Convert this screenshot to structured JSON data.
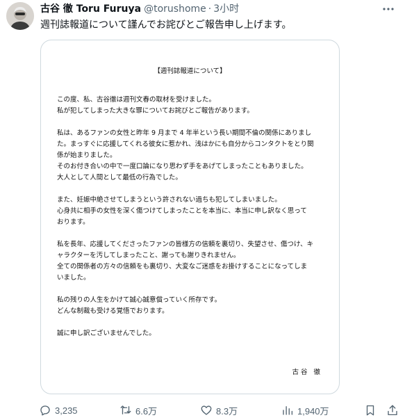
{
  "author": {
    "display_name": "古谷 徹 Toru Furuya",
    "handle": "@torushome",
    "separator": "·",
    "time": "3小时"
  },
  "tweet": {
    "text": "週刊誌報道について謹んでお詫びとご報告申し上げます。"
  },
  "document": {
    "title": "【週刊誌報道について】",
    "paragraphs": [
      [
        "この度、私、古谷徹は週刊文春の取材を受けました。",
        "私が犯してしまった大きな罪についてお詫びとご報告があります。"
      ],
      [
        "私は、あるファンの女性と昨年 9 月まで 4 年半という長い期間不倫の関係にありまし",
        "た。まっすぐに応援してくれる彼女に惹かれ、浅はかにも自分からコンタクトをとり関",
        "係が始まりました。",
        "そのお付き合いの中で一度口論になり思わず手をあげてしまったこともありました。",
        "大人として人間として最低の行為でした。"
      ],
      [
        "また、妊娠中絶させてしまうという許されない過ちも犯してしまいました。",
        "心身共に相手の女性を深く傷つけてしまったことを本当に、本当に申し訳なく思って",
        "おります。"
      ],
      [
        "私を長年、応援してくださったファンの皆様方の信頼を裏切り、失望させ、傷つけ、キ",
        "ャラクターを汚してしまったこと、謝っても謝りきれません。",
        "全ての関係者の方々の信頼をも裏切り、大変なご迷惑をお掛けすることになってしま",
        "いました。"
      ],
      [
        "私の残りの人生をかけて誠心誠意償っていく所存です。",
        "どんな制裁も受ける覚悟でおります。"
      ],
      [
        "誠に申し訳ございませんでした。"
      ]
    ],
    "signature": "古谷 徹"
  },
  "actions": {
    "replies": "3,235",
    "reposts": "6.6万",
    "likes": "8.3万",
    "views": "1,940万"
  },
  "icons": {
    "more": "more-horizontal-icon",
    "reply": "reply-bubble-icon",
    "repost": "repost-arrows-icon",
    "like": "heart-icon",
    "views": "analytics-bars-icon",
    "bookmark": "bookmark-icon",
    "share": "share-upload-icon"
  },
  "colors": {
    "text": "#0f1419",
    "secondary": "#536471",
    "border": "#cfd9de"
  }
}
